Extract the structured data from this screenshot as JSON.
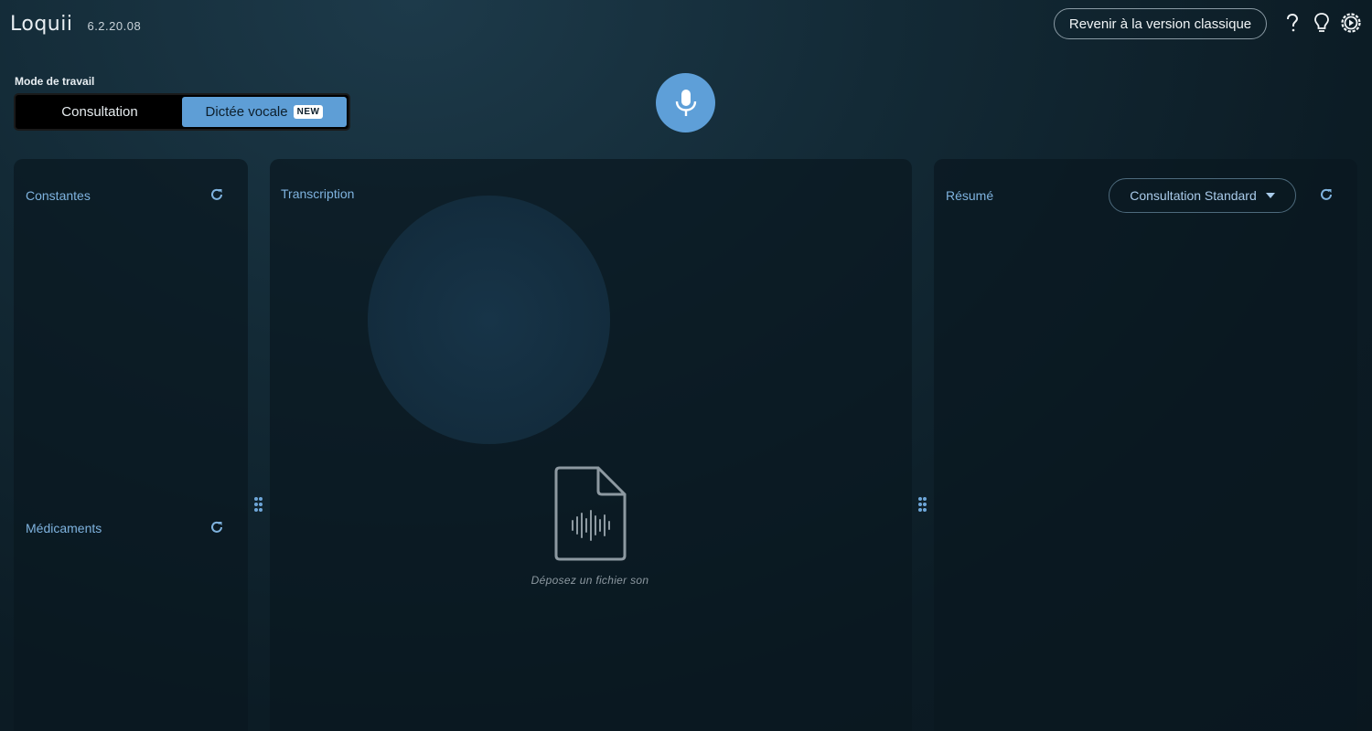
{
  "app": {
    "logo": "Loquii",
    "version": "6.2.20.08"
  },
  "header": {
    "classic_label": "Revenir à la version classique",
    "icons": [
      "help-icon",
      "lightbulb-icon",
      "settings-icon"
    ]
  },
  "mode": {
    "label": "Mode de travail",
    "options": [
      {
        "label": "Consultation",
        "active": false
      },
      {
        "label": "Dictée vocale",
        "active": true,
        "badge": "NEW"
      }
    ]
  },
  "panels": {
    "constantes": {
      "title": "Constantes"
    },
    "medicaments": {
      "title": "Médicaments"
    },
    "transcription": {
      "title": "Transcription",
      "drop_label": "Déposez un fichier son"
    },
    "resume": {
      "title": "Résumé",
      "template_value": "Consultation Standard"
    }
  },
  "colors": {
    "accent": "#5e9ed6",
    "panel_title": "#7fb3df",
    "background": "#0c1c25"
  }
}
